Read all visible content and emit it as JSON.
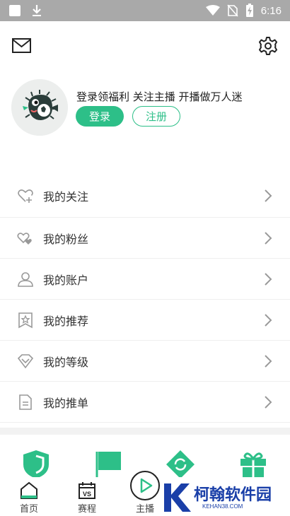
{
  "status_bar": {
    "time": "6:16",
    "icons": [
      "notification-square-icon",
      "download-icon",
      "wifi-icon",
      "no-sim-icon",
      "battery-charging-icon"
    ]
  },
  "header": {
    "icons": [
      "mail-icon",
      "gear-icon"
    ]
  },
  "profile": {
    "promo_text": "登录领福利 关注主播 开播做万人迷",
    "login_label": "登录",
    "register_label": "注册",
    "avatar_icon": "pufferfish-mascot-icon"
  },
  "menu": {
    "items": [
      {
        "label": "我的关注",
        "icon": "heart-plus-icon"
      },
      {
        "label": "我的粉丝",
        "icon": "hearts-icon"
      },
      {
        "label": "我的账户",
        "icon": "user-icon"
      },
      {
        "label": "我的推荐",
        "icon": "bookmark-star-icon"
      },
      {
        "label": "我的等级",
        "icon": "diamond-icon"
      },
      {
        "label": "我的推单",
        "icon": "document-icon"
      }
    ]
  },
  "features": {
    "icons": [
      "shield-icon",
      "flag-icon",
      "refresh-diamond-icon",
      "gift-icon"
    ]
  },
  "tabbar": {
    "tabs": [
      {
        "label": "首页",
        "icon": "home-icon"
      },
      {
        "label": "赛程",
        "icon": "calendar-vs-icon"
      },
      {
        "label": "主播",
        "icon": "play-icon"
      }
    ]
  },
  "watermark": {
    "text": "柯翰软件园",
    "sub": "KEHAN38.COM"
  },
  "colors": {
    "accent": "#2dbf88",
    "status_bar": "#a9a9a9",
    "watermark": "#1a3fa8"
  }
}
